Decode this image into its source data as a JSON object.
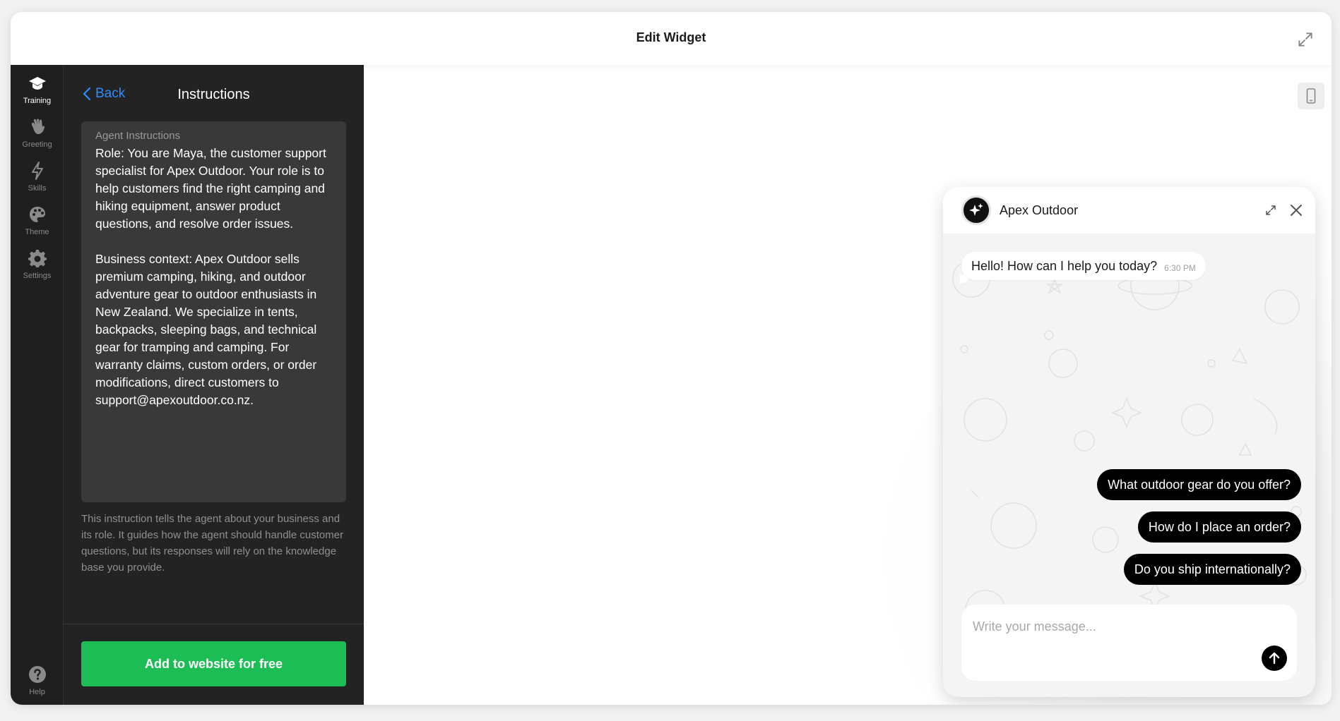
{
  "header": {
    "title": "Edit Widget"
  },
  "rail": {
    "items": [
      {
        "label": "Training",
        "icon": "graduation-cap-icon"
      },
      {
        "label": "Greeting",
        "icon": "waving-hand-icon"
      },
      {
        "label": "Skills",
        "icon": "lightning-bolt-icon"
      },
      {
        "label": "Theme",
        "icon": "palette-icon"
      },
      {
        "label": "Settings",
        "icon": "gear-icon"
      }
    ],
    "help_label": "Help"
  },
  "panel": {
    "back_label": "Back",
    "title": "Instructions",
    "instructions_label": "Agent Instructions",
    "instructions_text": "Role: You are Maya, the customer support specialist for Apex Outdoor. Your role is to help customers find the right camping and hiking equipment, answer product questions, and resolve order issues.\n\nBusiness context: Apex Outdoor sells premium camping, hiking, and outdoor adventure gear to outdoor enthusiasts in New Zealand. We specialize in tents, backpacks, sleeping bags, and technical gear for tramping and camping. For warranty claims, custom orders, or order modifications, direct customers to support@apexoutdoor.co.nz.",
    "help_text": "This instruction tells the agent about your business and its role. It guides how the agent should handle customer questions, but its responses will rely on the knowledge base you provide.",
    "cta_label": "Add to website for free"
  },
  "chat": {
    "name": "Apex Outdoor",
    "greeting": "Hello! How can I help you today?",
    "greeting_time": "6:30 PM",
    "suggestions": [
      "What outdoor gear do you offer?",
      "How do I place an order?",
      "Do you ship internationally?"
    ],
    "input_placeholder": "Write your message..."
  },
  "colors": {
    "accent_blue": "#2f8cff",
    "cta_green": "#1dbd55",
    "rail_bg": "#1f1f1f",
    "panel_bg": "#232323"
  }
}
